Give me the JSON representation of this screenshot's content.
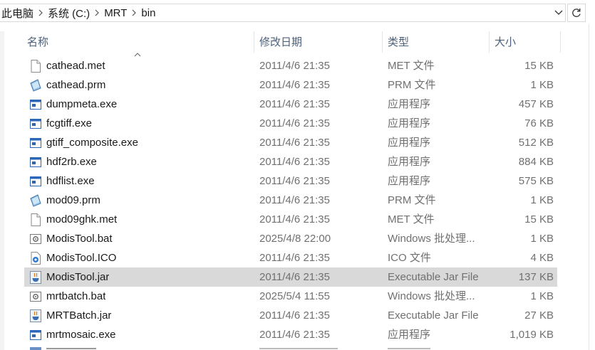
{
  "breadcrumb": [
    "此电脑",
    "系统 (C:)",
    "MRT",
    "bin"
  ],
  "columns": {
    "name": "名称",
    "date": "修改日期",
    "type": "类型",
    "size": "大小"
  },
  "files": [
    {
      "name": "cathead.met",
      "date": "2011/4/6 21:35",
      "type": "MET 文件",
      "size": "15 KB",
      "icon": "doc"
    },
    {
      "name": "cathead.prm",
      "date": "2011/4/6 21:35",
      "type": "PRM 文件",
      "size": "1 KB",
      "icon": "prm"
    },
    {
      "name": "dumpmeta.exe",
      "date": "2011/4/6 21:35",
      "type": "应用程序",
      "size": "457 KB",
      "icon": "exe"
    },
    {
      "name": "fcgtiff.exe",
      "date": "2011/4/6 21:35",
      "type": "应用程序",
      "size": "76 KB",
      "icon": "exe"
    },
    {
      "name": "gtiff_composite.exe",
      "date": "2011/4/6 21:35",
      "type": "应用程序",
      "size": "512 KB",
      "icon": "exe"
    },
    {
      "name": "hdf2rb.exe",
      "date": "2011/4/6 21:35",
      "type": "应用程序",
      "size": "884 KB",
      "icon": "exe"
    },
    {
      "name": "hdflist.exe",
      "date": "2011/4/6 21:35",
      "type": "应用程序",
      "size": "575 KB",
      "icon": "exe"
    },
    {
      "name": "mod09.prm",
      "date": "2011/4/6 21:35",
      "type": "PRM 文件",
      "size": "1 KB",
      "icon": "prm"
    },
    {
      "name": "mod09ghk.met",
      "date": "2011/4/6 21:35",
      "type": "MET 文件",
      "size": "15 KB",
      "icon": "doc"
    },
    {
      "name": "ModisTool.bat",
      "date": "2025/4/8 22:00",
      "type": "Windows 批处理...",
      "size": "1 KB",
      "icon": "bat"
    },
    {
      "name": "ModisTool.ICO",
      "date": "2011/4/6 21:35",
      "type": "ICO 文件",
      "size": "4 KB",
      "icon": "ico"
    },
    {
      "name": "ModisTool.jar",
      "date": "2011/4/6 21:35",
      "type": "Executable Jar File",
      "size": "137 KB",
      "icon": "jar",
      "selected": true
    },
    {
      "name": "mrtbatch.bat",
      "date": "2025/5/4 11:55",
      "type": "Windows 批处理...",
      "size": "1 KB",
      "icon": "bat"
    },
    {
      "name": "MRTBatch.jar",
      "date": "2011/4/6 21:35",
      "type": "Executable Jar File",
      "size": "27 KB",
      "icon": "jar"
    },
    {
      "name": "mrtmosaic.exe",
      "date": "2011/4/6 21:35",
      "type": "应用程序",
      "size": "1,019 KB",
      "icon": "exe"
    }
  ],
  "colors": {
    "selected_row": "#d9d9d9",
    "header_text": "#4c607a",
    "muted_text": "#707070"
  }
}
